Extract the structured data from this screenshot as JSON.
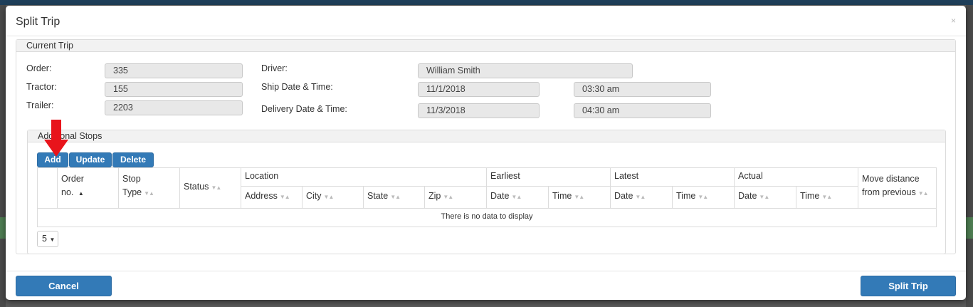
{
  "modal": {
    "title": "Split Trip",
    "close_label": "×"
  },
  "current_trip": {
    "heading": "Current Trip",
    "order_label": "Order:",
    "order_value": "335",
    "tractor_label": "Tractor:",
    "tractor_value": "155",
    "trailer_label": "Trailer:",
    "trailer_value": "2203",
    "driver_label": "Driver:",
    "driver_value": "William Smith",
    "ship_label": "Ship Date & Time:",
    "ship_date": "11/1/2018",
    "ship_time": "03:30 am",
    "delivery_label": "Delivery Date & Time:",
    "delivery_date": "11/3/2018",
    "delivery_time": "04:30 am"
  },
  "additional_stops": {
    "heading": "Additional Stops",
    "add_label": "Add",
    "update_label": "Update",
    "delete_label": "Delete",
    "columns": {
      "order_no_1": "Order",
      "order_no_2": "no.",
      "stop_type_1": "Stop",
      "stop_type_2": "Type",
      "status": "Status",
      "location": "Location",
      "address": "Address",
      "city": "City",
      "state": "State",
      "zip": "Zip",
      "earliest": "Earliest",
      "latest": "Latest",
      "actual": "Actual",
      "date": "Date",
      "time": "Time",
      "move_1": "Move distance",
      "move_2": "from previous"
    },
    "empty_message": "There is no data to display",
    "page_size": "5"
  },
  "footer": {
    "cancel_label": "Cancel",
    "split_label": "Split Trip"
  },
  "colors": {
    "primary": "#337ab7",
    "arrow": "#e8141b"
  }
}
